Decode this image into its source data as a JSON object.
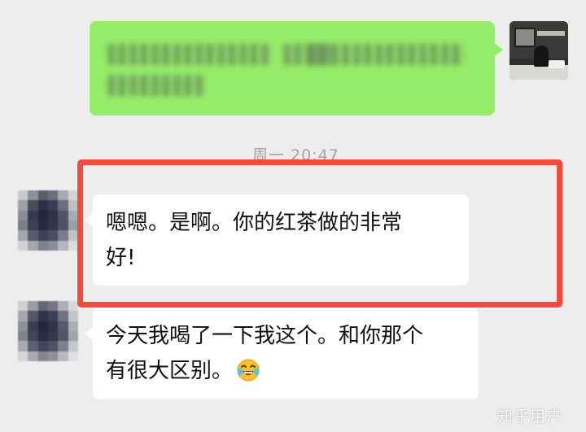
{
  "chat": {
    "timestamp": "周一 20:47",
    "messages": [
      {
        "direction": "received",
        "lines": [
          "嗯嗯。是啊。你的红茶做的非常",
          "好!"
        ],
        "highlighted": true
      },
      {
        "direction": "received",
        "lines": [
          "今天我喝了一下我这个。和你那个",
          "有很大区别。"
        ],
        "emoji": "laughing-with-tears-icon"
      }
    ]
  },
  "watermark": "知乎用户",
  "colors": {
    "sent_bubble": "#95ec69",
    "received_bubble": "#ffffff",
    "background": "#ededed",
    "highlight": "#f24a3b"
  }
}
